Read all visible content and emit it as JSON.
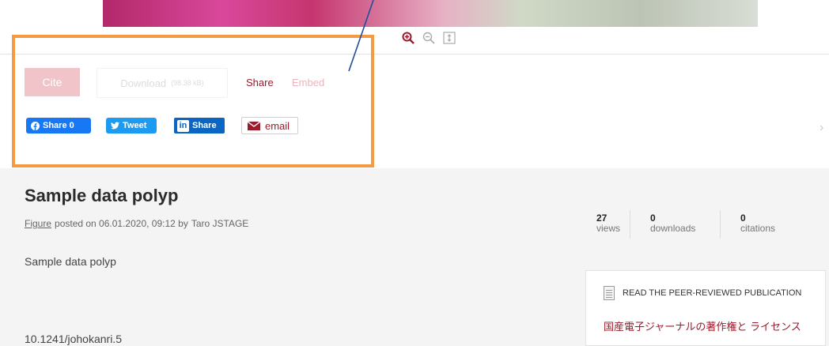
{
  "zoom": {
    "zoom_in_icon": "zoom-in-icon",
    "zoom_out_icon": "zoom-out-icon",
    "fit_icon": "fit-height-icon"
  },
  "actions": {
    "cite_label": "Cite",
    "download_label": "Download",
    "download_size": "(98.38 kB)",
    "share_label": "Share",
    "embed_label": "Embed"
  },
  "social": {
    "facebook_label": "Share 0",
    "twitter_label": "Tweet",
    "linkedin_logo": "in",
    "linkedin_label": "Share",
    "email_label": "email"
  },
  "item": {
    "title": "Sample data polyp",
    "type": "Figure",
    "posted_text": "posted on 06.01.2020, 09:12 by",
    "author": "Taro JSTAGE",
    "description": "Sample data polyp",
    "doi": "10.1241/johokanri.5"
  },
  "stats": [
    {
      "value": "27",
      "label": "views"
    },
    {
      "value": "0",
      "label": "downloads"
    },
    {
      "value": "0",
      "label": "citations"
    }
  ],
  "publication": {
    "heading": "READ THE PEER-REVIEWED PUBLICATION",
    "link": "国産電子ジャーナルの著作権と ライセンス"
  },
  "colors": {
    "accent": "#9a1b2d",
    "highlight": "#f39a45",
    "facebook": "#1877f2",
    "twitter": "#1d9bf0",
    "linkedin": "#0a66c2"
  }
}
